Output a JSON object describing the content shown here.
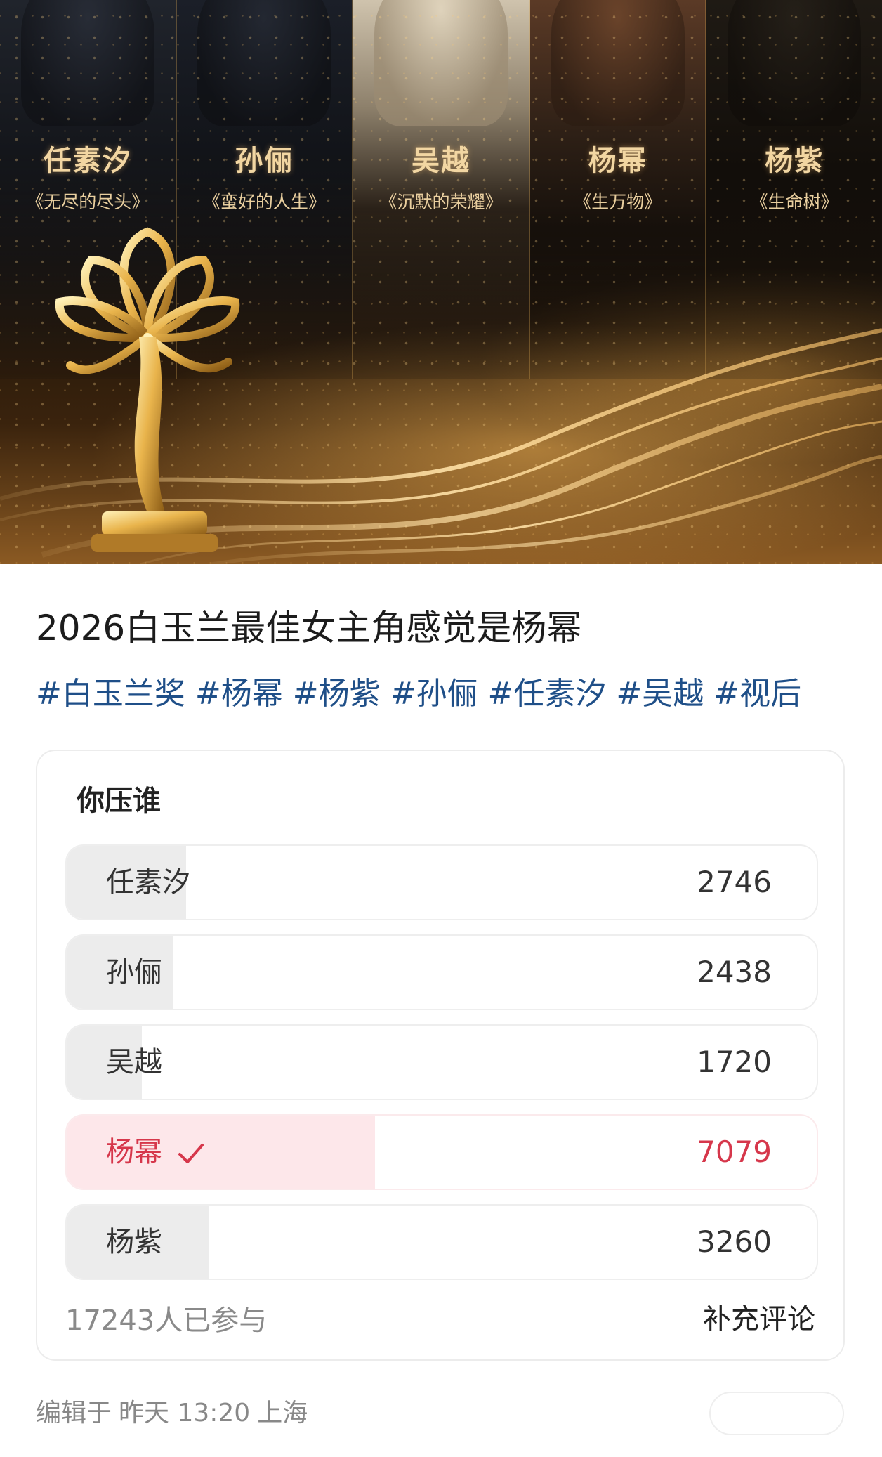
{
  "poster": {
    "panels": [
      {
        "name": "任素汐",
        "film": "《无尽的尽头》"
      },
      {
        "name": "孙俪",
        "film": "《蛮好的人生》"
      },
      {
        "name": "吴越",
        "film": "《沉默的荣耀》"
      },
      {
        "name": "杨幂",
        "film": "《生万物》"
      },
      {
        "name": "杨紫",
        "film": "《生命树》"
      }
    ]
  },
  "post": {
    "title": "2026白玉兰最佳女主角感觉是杨幂",
    "tags": [
      "#白玉兰奖",
      "#杨幂",
      "#杨紫",
      "#孙俪",
      "#任素汐",
      "#吴越",
      "#视后"
    ]
  },
  "poll": {
    "title": "你压谁",
    "options": [
      {
        "label": "任素汐",
        "count": "2746",
        "share": 0.159,
        "selected": false
      },
      {
        "label": "孙俪",
        "count": "2438",
        "share": 0.141,
        "selected": false
      },
      {
        "label": "吴越",
        "count": "1720",
        "share": 0.1,
        "selected": false
      },
      {
        "label": "杨幂",
        "count": "7079",
        "share": 0.411,
        "selected": true
      },
      {
        "label": "杨紫",
        "count": "3260",
        "share": 0.189,
        "selected": false
      }
    ],
    "participants": "17243人已参与",
    "add_comment": "补充评论"
  },
  "footer": {
    "edited_prefix": "编辑于",
    "edited_time": "昨天 13:20",
    "location": "上海"
  },
  "colors": {
    "accent": "#d6374b",
    "selected_fill": "#fde7ea",
    "option_fill": "#ececec",
    "tag": "#1f4f88"
  },
  "icons": {
    "check": "check-icon",
    "trophy": "magnolia-trophy-icon"
  }
}
